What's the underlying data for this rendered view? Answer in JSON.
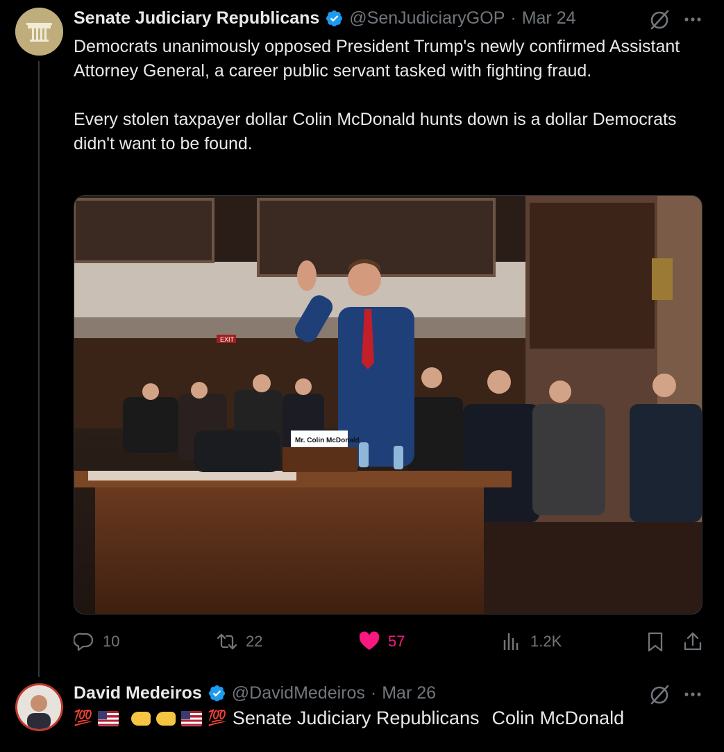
{
  "tweet": {
    "author_name": "Senate Judiciary Republicans",
    "handle": "@SenJudiciaryGOP",
    "separator": "·",
    "date": "Mar 24",
    "text_p1": "Democrats unanimously opposed President Trump's newly confirmed Assistant Attorney General, a career public servant tasked with fighting fraud.",
    "text_p2": "Every stolen taxpayer dollar Colin McDonald hunts down is a dollar Democrats didn't want to be found.",
    "image": {
      "nameplate": "Mr. Colin McDonald",
      "exit_sign": "EXIT"
    },
    "stats": {
      "replies": "10",
      "reposts": "22",
      "likes": "57",
      "views": "1.2K"
    },
    "like_color": "#f91880"
  },
  "reply": {
    "author_name": "David Medeiros",
    "handle": "@DavidMedeiros",
    "separator": "·",
    "date": "Mar 26",
    "emoji_100": "💯",
    "mention_1": "Senate Judiciary Republicans",
    "mention_2": "Colin McDonald"
  },
  "icons": {
    "verified": "verified-badge-icon",
    "grok": "grok-icon",
    "more": "more-icon",
    "reply": "reply-icon",
    "repost": "repost-icon",
    "like": "heart-icon",
    "views": "views-icon",
    "bookmark": "bookmark-icon",
    "share": "share-icon"
  },
  "colors": {
    "background": "#000000",
    "text": "#e7e9ea",
    "muted": "#71767b",
    "verified": "#1d9bf0"
  }
}
